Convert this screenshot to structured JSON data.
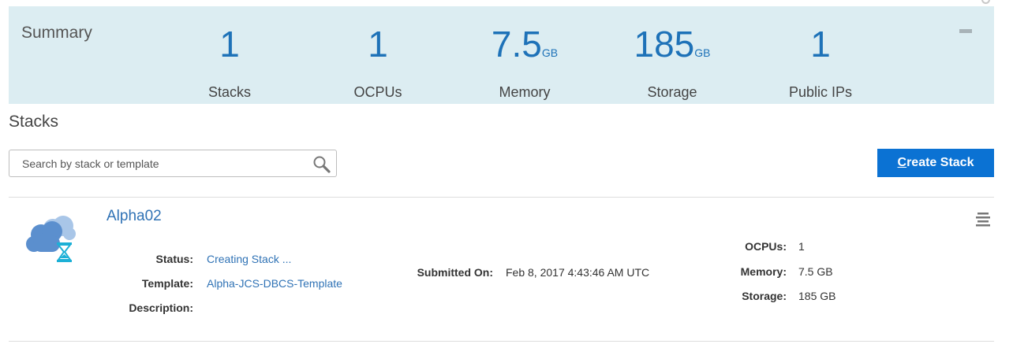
{
  "summary": {
    "title": "Summary",
    "metrics": [
      {
        "value": "1",
        "unit": "",
        "label": "Stacks"
      },
      {
        "value": "1",
        "unit": "",
        "label": "OCPUs"
      },
      {
        "value": "7.5",
        "unit": "GB",
        "label": "Memory"
      },
      {
        "value": "185",
        "unit": "GB",
        "label": "Storage"
      },
      {
        "value": "1",
        "unit": "",
        "label": "Public IPs"
      }
    ]
  },
  "stacks": {
    "heading": "Stacks",
    "search": {
      "placeholder": "Search by stack or template",
      "value": ""
    },
    "create_button": {
      "prefix": "C",
      "rest": "reate Stack"
    },
    "items": [
      {
        "name": "Alpha02",
        "status_label": "Status:",
        "status": "Creating Stack ...",
        "template_label": "Template:",
        "template": "Alpha-JCS-DBCS-Template",
        "description_label": "Description:",
        "description": "",
        "submitted_label": "Submitted On:",
        "submitted": "Feb 8, 2017 4:43:46 AM UTC",
        "ocpus_label": "OCPUs:",
        "ocpus": "1",
        "memory_label": "Memory:",
        "memory": "7.5 GB",
        "storage_label": "Storage:",
        "storage": "185 GB"
      }
    ]
  },
  "colors": {
    "summary_bg": "#dcedf2",
    "accent": "#1e72b8",
    "button": "#0b72d3",
    "link": "#2f72b5"
  },
  "icons": [
    "search-icon",
    "cloud-stack-icon",
    "hourglass-icon",
    "menu-icon",
    "collapse-icon"
  ]
}
